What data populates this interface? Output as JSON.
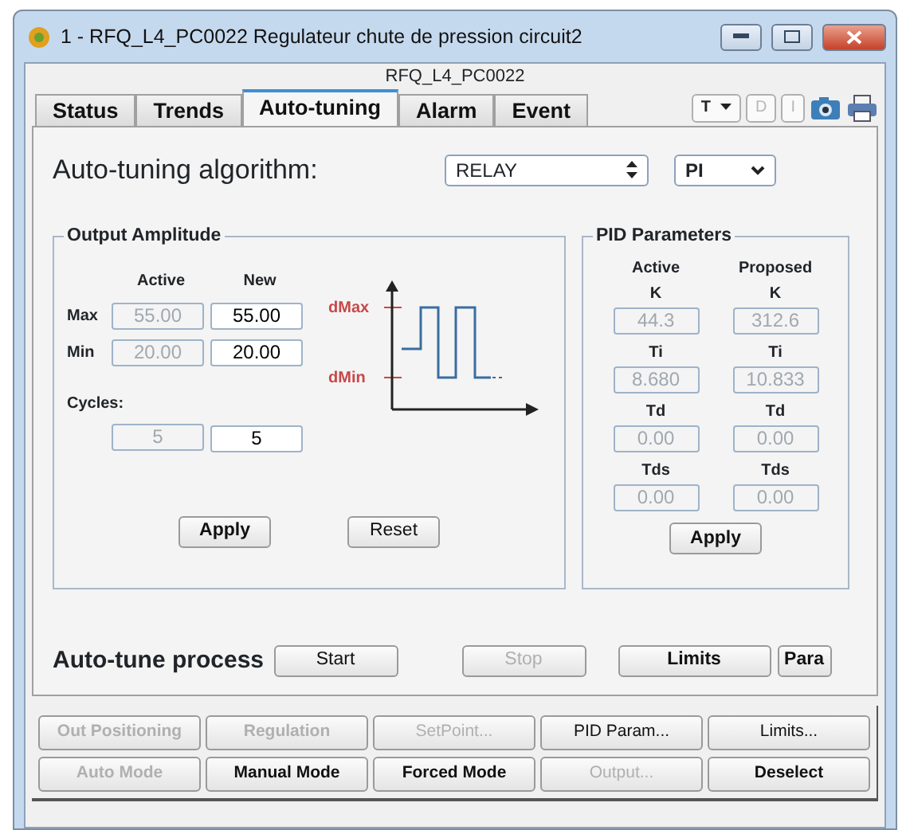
{
  "window": {
    "title": "1 - RFQ_L4_PC0022 Regulateur chute de pression circuit2"
  },
  "subtitle": "RFQ_L4_PC0022",
  "tabs": [
    {
      "label": "Status",
      "selected": false
    },
    {
      "label": "Trends",
      "selected": false
    },
    {
      "label": "Auto-tuning",
      "selected": true
    },
    {
      "label": "Alarm",
      "selected": false
    },
    {
      "label": "Event",
      "selected": false
    }
  ],
  "toolbar": {
    "dropdown": "T",
    "buttons": [
      {
        "label": "D",
        "disabled": true
      },
      {
        "label": "I",
        "disabled": true
      }
    ]
  },
  "algorithm": {
    "label": "Auto-tuning algorithm:",
    "value": "RELAY",
    "mode": "PI"
  },
  "output_amplitude": {
    "title": "Output Amplitude",
    "columns": [
      "Active",
      "New"
    ],
    "rows": [
      {
        "label": "Max",
        "active": "55.00",
        "new": "55.00"
      },
      {
        "label": "Min",
        "active": "20.00",
        "new": "20.00"
      }
    ],
    "cycles_label": "Cycles:",
    "cycles": {
      "active": "5",
      "new": "5"
    },
    "diagram": {
      "max_label": "dMax",
      "min_label": "dMin"
    },
    "buttons": [
      "Apply",
      "Reset"
    ]
  },
  "pid_parameters": {
    "title": "PID Parameters",
    "columns": [
      "Active",
      "Proposed"
    ],
    "params": [
      {
        "active_name": "K",
        "proposed_name": "K",
        "active": "44.3",
        "proposed": "312.6"
      },
      {
        "active_name": "Ti",
        "proposed_name": "Ti",
        "active": "8.680",
        "proposed": "10.833"
      },
      {
        "active_name": "Td",
        "proposed_name": "Td",
        "active": "0.00",
        "proposed": "0.00"
      },
      {
        "active_name": "Tds",
        "proposed_name": "Tds",
        "active": "0.00",
        "proposed": "0.00"
      }
    ],
    "button": "Apply"
  },
  "process": {
    "label": "Auto-tune process",
    "buttons": [
      {
        "label": "Start",
        "disabled": false,
        "bold": false
      },
      {
        "label": "Stop",
        "disabled": true,
        "bold": false
      },
      {
        "label": "Limits",
        "disabled": false,
        "bold": true
      },
      {
        "label": "Para",
        "disabled": false,
        "bold": true
      }
    ]
  },
  "commands": [
    {
      "label": "Out Positioning",
      "disabled": true,
      "bold": true
    },
    {
      "label": "Regulation",
      "disabled": true,
      "bold": true
    },
    {
      "label": "SetPoint...",
      "disabled": true,
      "bold": false
    },
    {
      "label": "PID Param...",
      "disabled": false,
      "bold": false
    },
    {
      "label": "Limits...",
      "disabled": false,
      "bold": false
    },
    {
      "label": "Auto Mode",
      "disabled": true,
      "bold": true
    },
    {
      "label": "Manual Mode",
      "disabled": false,
      "bold": true
    },
    {
      "label": "Forced Mode",
      "disabled": false,
      "bold": true
    },
    {
      "label": "Output...",
      "disabled": true,
      "bold": false
    },
    {
      "label": "Deselect",
      "disabled": false,
      "bold": true
    }
  ]
}
